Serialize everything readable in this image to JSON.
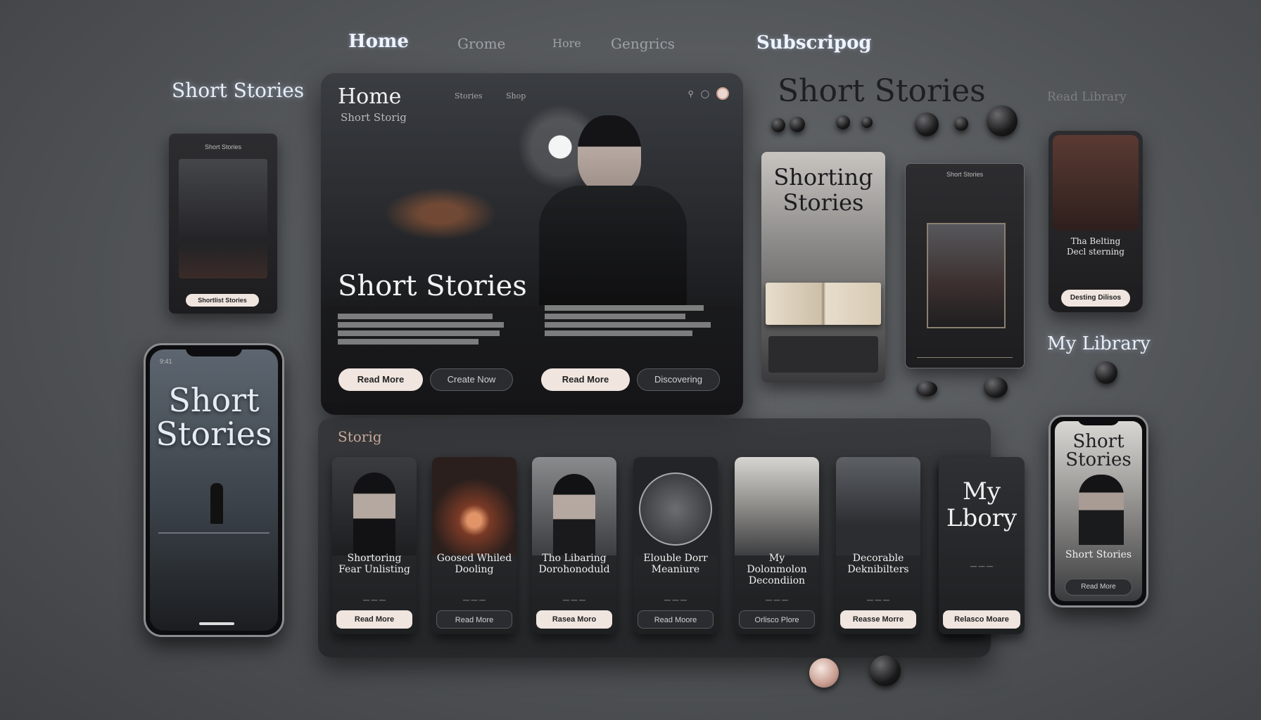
{
  "nav": {
    "home": "Home",
    "item2": "Grome",
    "item3": "Hore",
    "item4": "Gengrics",
    "subscribe": "Subscripog",
    "read_library": "Read Library"
  },
  "left": {
    "section_title": "Short Stories",
    "book": {
      "header": "Short Stories",
      "btn": "Shortlist Stories"
    },
    "phone": {
      "status": "9:41",
      "title_line1": "Short",
      "title_line2": "Stories"
    }
  },
  "hero": {
    "heading": "Home",
    "subheading": "Short Storig",
    "topnav": [
      "Stories",
      "Shop"
    ],
    "title": "Short Stories",
    "primary_button": "Read More",
    "secondary_button": "Create Now",
    "read_more_button": "Read More",
    "discover_button": "Discovering"
  },
  "right": {
    "section_title": "Short Stories",
    "book_title_line1": "Shorting",
    "book_title_line2": "Stories",
    "card_title": "Short Stories",
    "feature_line1": "Tha Belting",
    "feature_line2": "Decl sterning",
    "feature_btn": "Desting Dilisos",
    "library_title": "My Library",
    "phone": {
      "title_line1": "Short",
      "title_line2": "Stories",
      "caption": "Short Stories",
      "btn": "Read More"
    }
  },
  "stories": {
    "section_label": "Storig",
    "cards": [
      {
        "title": "Shortoring Fear Unlisting",
        "button": "Read More"
      },
      {
        "title": "Goosed Whiled Dooling",
        "button": "Read More"
      },
      {
        "title": "Tho Libaring Dorohonoduld",
        "button": "Rasea Moro"
      },
      {
        "title": "Elouble Dorr Meaniure",
        "button": "Read Moore"
      },
      {
        "title": "My Dolonmolon Decondiion",
        "button": "Orlisco Plore"
      },
      {
        "title": "Decorable Deknibilters",
        "button": "Reasse Morre"
      },
      {
        "title": "My Lbory",
        "button": "Relasco Moare"
      }
    ]
  },
  "colors": {
    "accent_light": "#f0e5df",
    "accent_pink": "#ead7cf",
    "panel_dark": "#1b1c1e"
  }
}
